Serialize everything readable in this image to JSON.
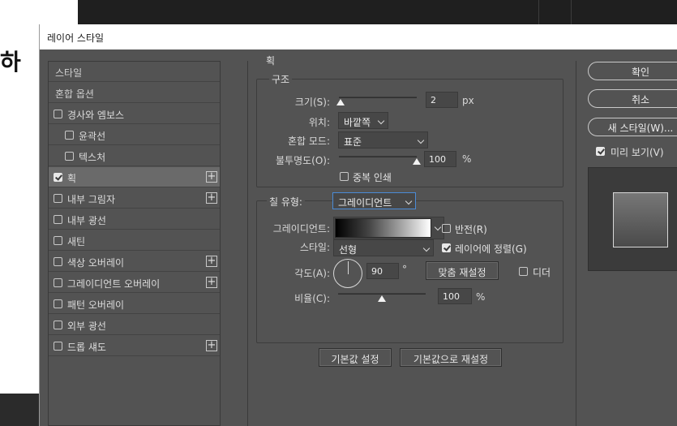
{
  "background": {
    "glyph": "하"
  },
  "dialog": {
    "title": "레이어 스타일",
    "styles_list": [
      {
        "label": "스타일",
        "checkbox": false,
        "checked": false,
        "plus": false,
        "indent": false,
        "selected": false
      },
      {
        "label": "혼합 옵션",
        "checkbox": false,
        "checked": false,
        "plus": false,
        "indent": false,
        "selected": false
      },
      {
        "label": "경사와 엠보스",
        "checkbox": true,
        "checked": false,
        "plus": false,
        "indent": false,
        "selected": false
      },
      {
        "label": "윤곽선",
        "checkbox": true,
        "checked": false,
        "plus": false,
        "indent": true,
        "selected": false
      },
      {
        "label": "텍스처",
        "checkbox": true,
        "checked": false,
        "plus": false,
        "indent": true,
        "selected": false
      },
      {
        "label": "획",
        "checkbox": true,
        "checked": true,
        "plus": true,
        "indent": false,
        "selected": true
      },
      {
        "label": "내부 그림자",
        "checkbox": true,
        "checked": false,
        "plus": true,
        "indent": false,
        "selected": false
      },
      {
        "label": "내부 광선",
        "checkbox": true,
        "checked": false,
        "plus": false,
        "indent": false,
        "selected": false
      },
      {
        "label": "새틴",
        "checkbox": true,
        "checked": false,
        "plus": false,
        "indent": false,
        "selected": false
      },
      {
        "label": "색상 오버레이",
        "checkbox": true,
        "checked": false,
        "plus": true,
        "indent": false,
        "selected": false
      },
      {
        "label": "그레이디언트 오버레이",
        "checkbox": true,
        "checked": false,
        "plus": true,
        "indent": false,
        "selected": false
      },
      {
        "label": "패턴 오버레이",
        "checkbox": true,
        "checked": false,
        "plus": false,
        "indent": false,
        "selected": false
      },
      {
        "label": "외부 광선",
        "checkbox": true,
        "checked": false,
        "plus": false,
        "indent": false,
        "selected": false
      },
      {
        "label": "드롭 섀도",
        "checkbox": true,
        "checked": false,
        "plus": true,
        "indent": false,
        "selected": false
      }
    ],
    "stroke": {
      "section_title": "획",
      "structure_title": "구조",
      "size_label": "크기(S):",
      "size_value": "2",
      "size_unit": "px",
      "size_slider": 0.02,
      "position_label": "위치:",
      "position_value": "바깥쪽",
      "blend_label": "혼합 모드:",
      "blend_value": "표준",
      "opacity_label": "불투명도(O):",
      "opacity_value": "100",
      "opacity_unit": "%",
      "opacity_slider": 1.0,
      "overprint_label": "중복 인쇄",
      "overprint_checked": false,
      "fill_type_label": "칠 유형:",
      "fill_type_value": "그레이디언트",
      "gradient_label": "그레이디언트:",
      "reverse_label": "반전(R)",
      "reverse_checked": false,
      "style_label": "스타일:",
      "style_value": "선형",
      "align_label": "레이어에 정렬(G)",
      "align_checked": true,
      "angle_label": "각도(A):",
      "angle_value": "90",
      "angle_unit": "°",
      "reset_align_label": "맞춤 재설정",
      "dither_label": "디더",
      "dither_checked": false,
      "scale_label": "비율(C):",
      "scale_value": "100",
      "scale_unit": "%",
      "scale_slider": 0.5,
      "make_default_label": "기본값 설정",
      "reset_default_label": "기본값으로 재설정"
    },
    "buttons": {
      "ok": "확인",
      "cancel": "취소",
      "new_style": "새 스타일(W)...",
      "preview_label": "미리 보기(V)",
      "preview_checked": true
    }
  }
}
